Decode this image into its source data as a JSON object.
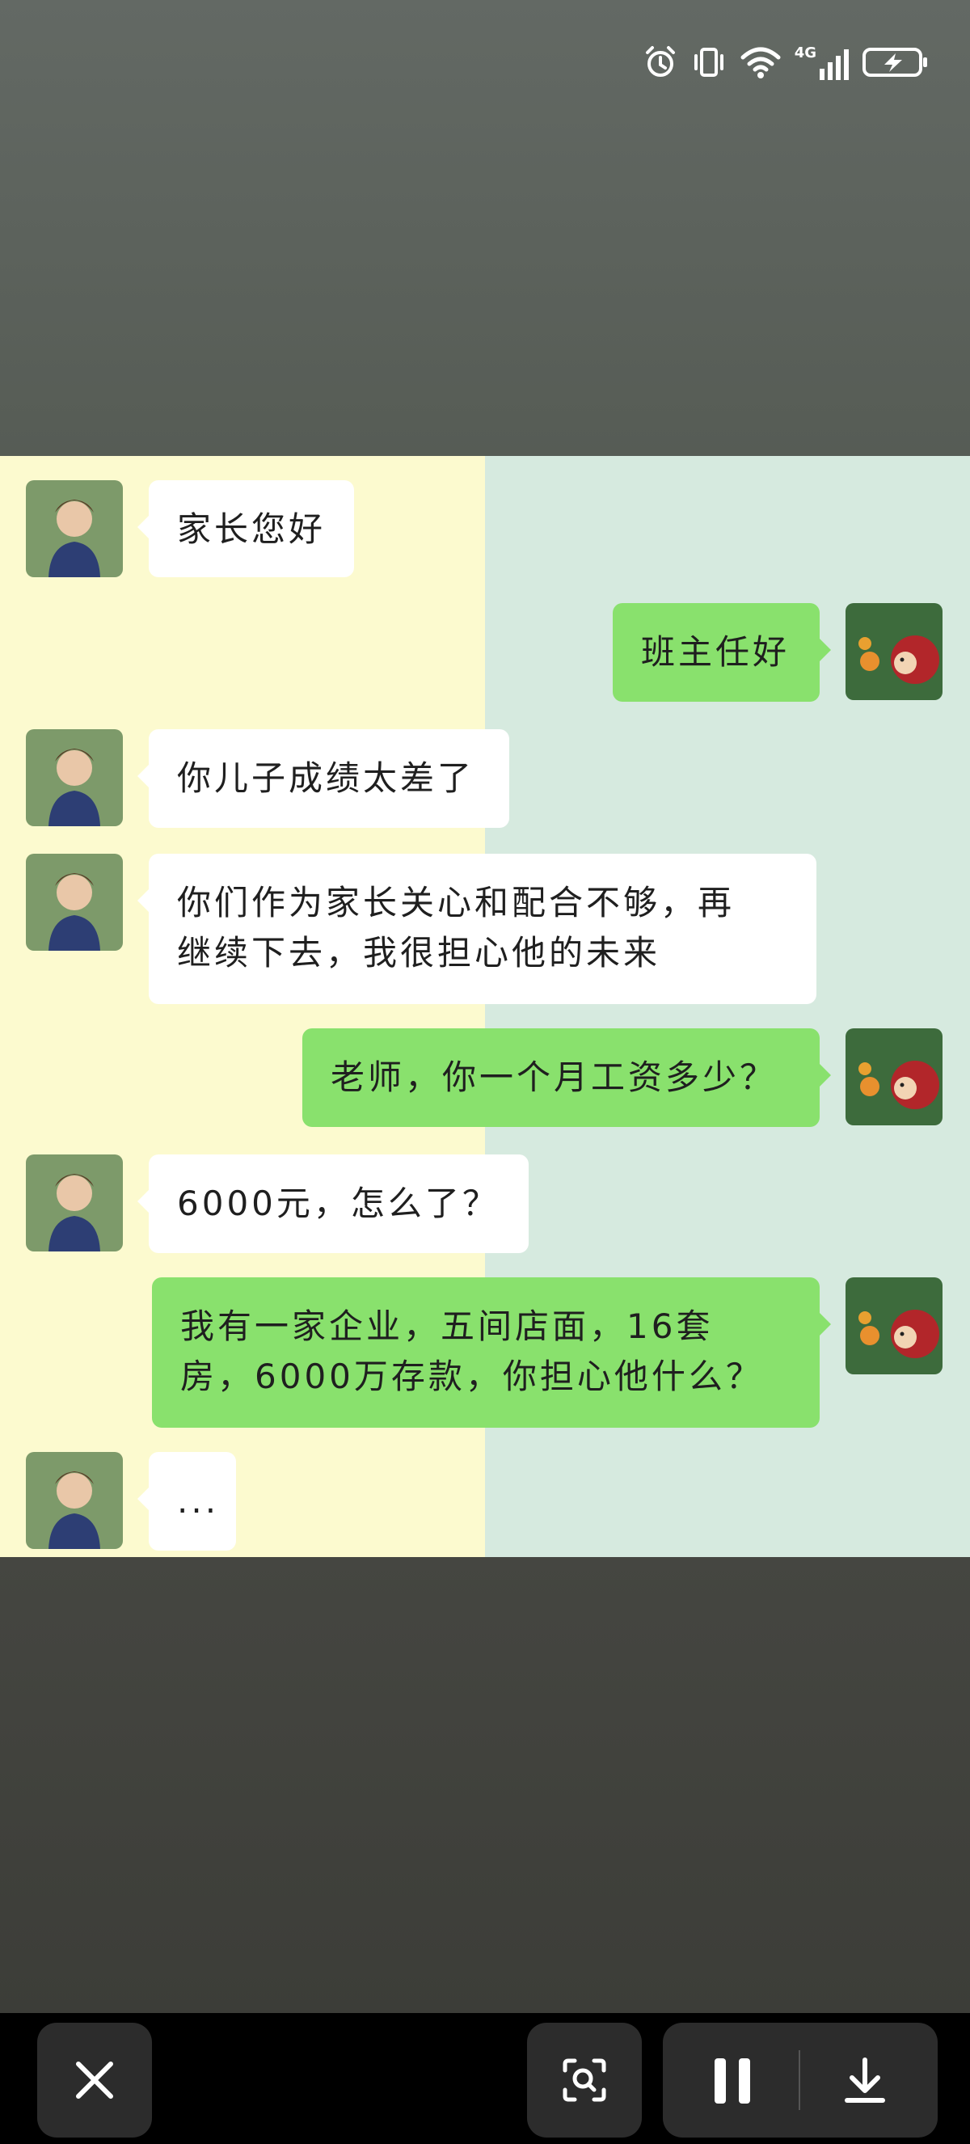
{
  "status_bar": {
    "left_text": "",
    "icons": [
      "alarm-icon",
      "vibrate-icon",
      "wifi-icon",
      "signal-4g-icon",
      "battery-charging-icon"
    ],
    "network_label": "4G"
  },
  "chat": {
    "colors": {
      "left_bg": "#fcfacf",
      "right_bg": "#d6eadf",
      "sent_bubble": "#89e16d",
      "received_bubble": "#ffffff"
    },
    "messages": [
      {
        "side": "left",
        "text": "家长您好"
      },
      {
        "side": "right",
        "text": "班主任好"
      },
      {
        "side": "left",
        "text": "你儿子成绩太差了"
      },
      {
        "side": "left",
        "line1": "你们作为家长关心和配合不够，再",
        "line2": "继续下去，我很担心他的未来"
      },
      {
        "side": "right",
        "text": "老师，你一个月工资多少？"
      },
      {
        "side": "left",
        "text": "6000元，怎么了？"
      },
      {
        "side": "right",
        "line1": "我有一家企业，五间店面，16套",
        "line2": "房，6000万存款，你担心他什么？"
      },
      {
        "side": "left",
        "text": "..."
      }
    ]
  },
  "toolbar": {
    "icons": [
      "close-icon",
      "screen-search-icon",
      "pause-icon",
      "download-icon"
    ]
  }
}
